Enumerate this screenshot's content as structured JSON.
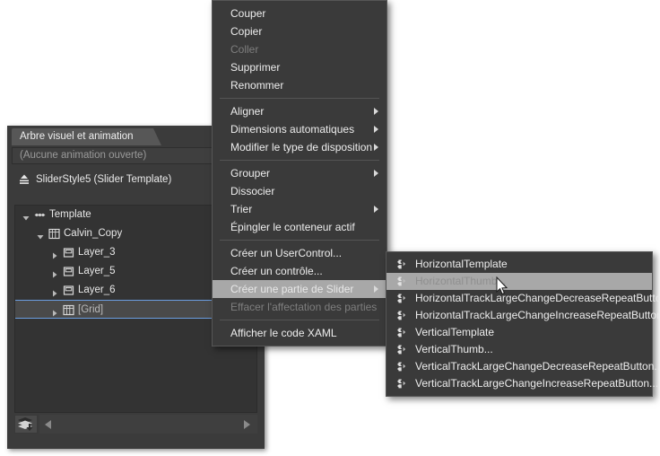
{
  "panel": {
    "tab_label": "Arbre visuel et animation",
    "animation_combo": {
      "value": "(Aucune animation ouverte)",
      "chevron_icon": "double-chevron-down-icon"
    },
    "scope": {
      "icon": "return-to-scope-icon",
      "label": "SliderStyle5 (Slider Template)"
    },
    "tree": [
      {
        "label": "Template",
        "icon": "template-icon",
        "depth": 0,
        "twisty": "expanded",
        "selected": false,
        "muted": false
      },
      {
        "label": "Calvin_Copy",
        "icon": "grid-icon",
        "depth": 1,
        "twisty": "expanded",
        "selected": false,
        "muted": false
      },
      {
        "label": "Layer_3",
        "icon": "border-icon",
        "depth": 2,
        "twisty": "collapsed",
        "selected": false,
        "muted": false
      },
      {
        "label": "Layer_5",
        "icon": "border-icon",
        "depth": 2,
        "twisty": "collapsed",
        "selected": false,
        "muted": false
      },
      {
        "label": "Layer_6",
        "icon": "border-icon",
        "depth": 2,
        "twisty": "collapsed",
        "selected": false,
        "muted": false
      },
      {
        "label": "[Grid]",
        "icon": "grid-icon",
        "depth": 2,
        "twisty": "collapsed",
        "selected": true,
        "muted": true
      }
    ],
    "bottom_bar": {
      "stack_button_icon": "layers-down-icon",
      "scroll_left_icon": "triangle-left-icon",
      "scroll_right_icon": "triangle-right-icon"
    }
  },
  "context_menu": {
    "items": [
      {
        "label": "Couper",
        "type": "item",
        "disabled": false,
        "submenu": false
      },
      {
        "label": "Copier",
        "type": "item",
        "disabled": false,
        "submenu": false
      },
      {
        "label": "Coller",
        "type": "item",
        "disabled": true,
        "submenu": false
      },
      {
        "label": "Supprimer",
        "type": "item",
        "disabled": false,
        "submenu": false
      },
      {
        "label": "Renommer",
        "type": "item",
        "disabled": false,
        "submenu": false
      },
      {
        "label": "",
        "type": "separator"
      },
      {
        "label": "Aligner",
        "type": "item",
        "disabled": false,
        "submenu": true
      },
      {
        "label": "Dimensions automatiques",
        "type": "item",
        "disabled": false,
        "submenu": true
      },
      {
        "label": "Modifier le type de disposition",
        "type": "item",
        "disabled": false,
        "submenu": true
      },
      {
        "label": "",
        "type": "separator"
      },
      {
        "label": "Grouper",
        "type": "item",
        "disabled": false,
        "submenu": true
      },
      {
        "label": "Dissocier",
        "type": "item",
        "disabled": false,
        "submenu": false
      },
      {
        "label": "Trier",
        "type": "item",
        "disabled": false,
        "submenu": true
      },
      {
        "label": "Épingler le conteneur actif",
        "type": "item",
        "disabled": false,
        "submenu": false
      },
      {
        "label": "",
        "type": "separator"
      },
      {
        "label": "Créer un UserControl...",
        "type": "item",
        "disabled": false,
        "submenu": false
      },
      {
        "label": "Créer un contrôle...",
        "type": "item",
        "disabled": false,
        "submenu": false
      },
      {
        "label": "Créer une partie de Slider",
        "type": "item",
        "disabled": false,
        "submenu": true,
        "highlight": true
      },
      {
        "label": "Effacer l'affectation des parties",
        "type": "item",
        "disabled": true,
        "submenu": false
      },
      {
        "label": "",
        "type": "separator"
      },
      {
        "label": "Afficher le code XAML",
        "type": "item",
        "disabled": false,
        "submenu": false
      }
    ]
  },
  "slider_submenu": {
    "items": [
      {
        "label": "HorizontalTemplate",
        "icon": "slider-part-icon",
        "highlight": false
      },
      {
        "label": "HorizontalThumb...",
        "icon": "slider-part-icon",
        "highlight": true
      },
      {
        "label": "HorizontalTrackLargeChangeDecreaseRepeatButton...",
        "icon": "slider-part-icon",
        "highlight": false
      },
      {
        "label": "HorizontalTrackLargeChangeIncreaseRepeatButton...",
        "icon": "slider-part-icon",
        "highlight": false
      },
      {
        "label": "VerticalTemplate",
        "icon": "slider-part-icon",
        "highlight": false
      },
      {
        "label": "VerticalThumb...",
        "icon": "slider-part-icon",
        "highlight": false
      },
      {
        "label": "VerticalTrackLargeChangeDecreaseRepeatButton...",
        "icon": "slider-part-icon",
        "highlight": false
      },
      {
        "label": "VerticalTrackLargeChangeIncreaseRepeatButton...",
        "icon": "slider-part-icon",
        "highlight": false
      }
    ]
  },
  "cursor": {
    "icon": "arrow-cursor-icon"
  },
  "colors": {
    "panel_bg": "#3b3b3b",
    "tree_bg": "#333333",
    "menu_bg": "#3a3a3a",
    "menu_border": "#565656",
    "highlight": "#a8a8a8",
    "selection_border": "#6b9de0",
    "text": "#ededed",
    "text_disabled": "#7e7e7e"
  }
}
